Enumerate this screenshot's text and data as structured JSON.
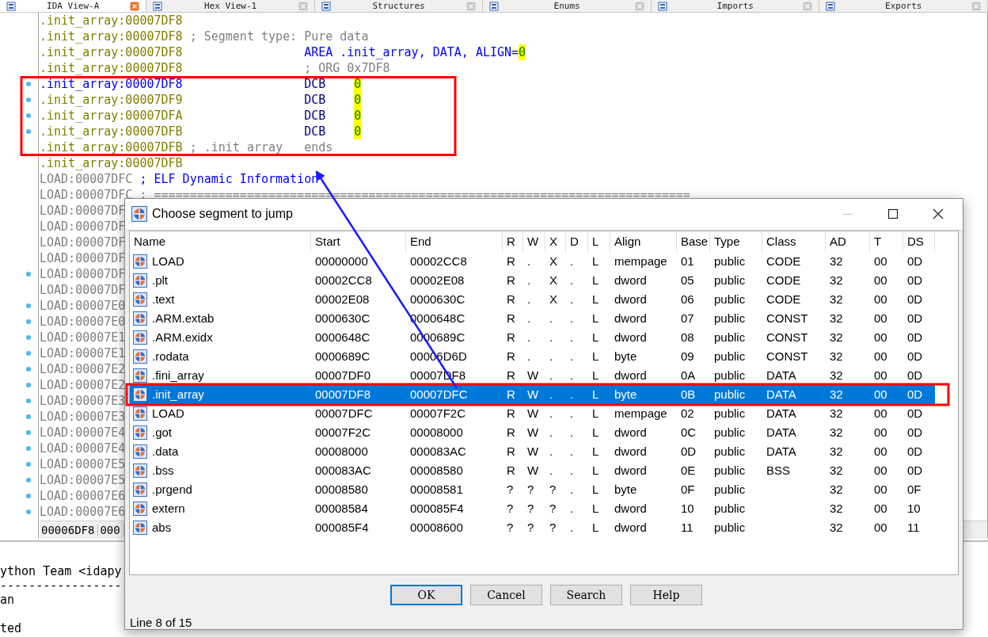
{
  "tabs": [
    {
      "label": "IDA View-A",
      "selected": true
    },
    {
      "label": "Hex View-1",
      "selected": false
    },
    {
      "label": "Structures",
      "selected": false
    },
    {
      "label": "Enums",
      "selected": false
    },
    {
      "label": "Imports",
      "selected": false
    },
    {
      "label": "Exports",
      "selected": false
    }
  ],
  "listing": {
    "lines": [
      {
        "address": ".init_array:00007DF8",
        "greyed": false,
        "current": false,
        "marked": false
      },
      {
        "address": ".init_array:00007DF8",
        "greyed": false,
        "current": false,
        "marked": false,
        "parts": [
          {
            "text": "; Segment type: Pure data",
            "kind": "comment"
          }
        ]
      },
      {
        "address": ".init_array:00007DF8",
        "greyed": false,
        "current": false,
        "marked": false,
        "parts": [
          {
            "text": "AREA .init_array, DATA, ALIGN=",
            "kind": "directive"
          },
          {
            "text": "0",
            "kind": "number"
          }
        ]
      },
      {
        "address": ".init_array:00007DF8",
        "greyed": false,
        "current": false,
        "marked": false,
        "parts": [
          {
            "text": "; ORG 0x7DF8",
            "kind": "column_comment"
          }
        ]
      },
      {
        "address": ".init_array:00007DF8",
        "greyed": false,
        "current": true,
        "marked": true,
        "parts": [
          {
            "text": "DCB",
            "kind": "mnemonic"
          },
          {
            "text": "0",
            "kind": "number"
          }
        ]
      },
      {
        "address": ".init_array:00007DF9",
        "greyed": false,
        "current": false,
        "marked": true,
        "parts": [
          {
            "text": "DCB",
            "kind": "mnemonic"
          },
          {
            "text": "0",
            "kind": "number"
          }
        ]
      },
      {
        "address": ".init_array:00007DFA",
        "greyed": false,
        "current": false,
        "marked": true,
        "parts": [
          {
            "text": "DCB",
            "kind": "mnemonic"
          },
          {
            "text": "0",
            "kind": "number"
          }
        ]
      },
      {
        "address": ".init_array:00007DFB",
        "greyed": false,
        "current": false,
        "marked": true,
        "parts": [
          {
            "text": "DCB",
            "kind": "mnemonic"
          },
          {
            "text": "0",
            "kind": "number"
          }
        ]
      },
      {
        "address": ".init_array:00007DFB",
        "greyed": false,
        "current": false,
        "marked": false,
        "parts": [
          {
            "text": "; .init_array",
            "kind": "comment"
          },
          {
            "text": "ends",
            "kind": "column_comment"
          }
        ]
      },
      {
        "address": ".init_array:00007DFB",
        "greyed": false,
        "current": false,
        "marked": false
      },
      {
        "address": "LOAD:00007DFC",
        "greyed": true,
        "current": false,
        "marked": false,
        "parts": [
          {
            "text": "; ELF Dynamic Information",
            "kind": "info"
          }
        ]
      },
      {
        "address": "LOAD:00007DFC",
        "greyed": true,
        "current": false,
        "marked": false,
        "parts": [
          {
            "text": "; ===========================================================================",
            "kind": "comment"
          }
        ]
      },
      {
        "address": "LOAD:00007DF",
        "greyed": true,
        "current": false,
        "marked": false
      },
      {
        "address": "LOAD:00007DF",
        "greyed": true,
        "current": false,
        "marked": false
      },
      {
        "address": "LOAD:00007DF",
        "greyed": true,
        "current": false,
        "marked": false
      },
      {
        "address": "LOAD:00007DF",
        "greyed": true,
        "current": false,
        "marked": false
      },
      {
        "address": "LOAD:00007DF",
        "greyed": true,
        "current": false,
        "marked": true
      },
      {
        "address": "LOAD:00007DF",
        "greyed": true,
        "current": false,
        "marked": false
      },
      {
        "address": "LOAD:00007E0",
        "greyed": true,
        "current": false,
        "marked": true
      },
      {
        "address": "LOAD:00007E0",
        "greyed": true,
        "current": false,
        "marked": true
      },
      {
        "address": "LOAD:00007E1",
        "greyed": true,
        "current": false,
        "marked": true
      },
      {
        "address": "LOAD:00007E1",
        "greyed": true,
        "current": false,
        "marked": true
      },
      {
        "address": "LOAD:00007E2",
        "greyed": true,
        "current": false,
        "marked": true
      },
      {
        "address": "LOAD:00007E2",
        "greyed": true,
        "current": false,
        "marked": true
      },
      {
        "address": "LOAD:00007E3",
        "greyed": true,
        "current": false,
        "marked": true
      },
      {
        "address": "LOAD:00007E3",
        "greyed": true,
        "current": false,
        "marked": true
      },
      {
        "address": "LOAD:00007E4",
        "greyed": true,
        "current": false,
        "marked": true
      },
      {
        "address": "LOAD:00007E4",
        "greyed": true,
        "current": false,
        "marked": true
      },
      {
        "address": "LOAD:00007E5",
        "greyed": true,
        "current": false,
        "marked": true
      },
      {
        "address": "LOAD:00007E5",
        "greyed": true,
        "current": false,
        "marked": true
      },
      {
        "address": "LOAD:00007E6",
        "greyed": true,
        "current": false,
        "marked": true
      },
      {
        "address": "LOAD:00007E6",
        "greyed": true,
        "current": false,
        "marked": true
      }
    ],
    "status": [
      "00006DF8",
      "000"
    ]
  },
  "output": {
    "lines": [
      {
        "text": "ython Team <idapy",
        "blank_before": false
      },
      {
        "text": "-----------------",
        "blank_before": false
      },
      {
        "text": "an",
        "blank_before": false
      },
      {
        "text": "ted",
        "blank_before": true
      }
    ]
  },
  "dialog": {
    "title": "Choose segment to jump",
    "window_controls": [
      {
        "kind": "minimize",
        "disabled": true
      },
      {
        "kind": "maximize",
        "disabled": false
      },
      {
        "kind": "close",
        "disabled": false
      }
    ],
    "columns": [
      "Name",
      "Start",
      "End",
      "R",
      "W",
      "X",
      "D",
      "L",
      "Align",
      "Base",
      "Type",
      "Class",
      "AD",
      "T",
      "DS"
    ],
    "rows": [
      {
        "selected": false,
        "cells": [
          "LOAD",
          "00000000",
          "00002CC8",
          "R",
          ".",
          "X",
          ".",
          "L",
          "mempage",
          "01",
          "public",
          "CODE",
          "32",
          "00",
          "0D"
        ]
      },
      {
        "selected": false,
        "cells": [
          ".plt",
          "00002CC8",
          "00002E08",
          "R",
          ".",
          "X",
          ".",
          "L",
          "dword",
          "05",
          "public",
          "CODE",
          "32",
          "00",
          "0D"
        ]
      },
      {
        "selected": false,
        "cells": [
          ".text",
          "00002E08",
          "0000630C",
          "R",
          ".",
          "X",
          ".",
          "L",
          "dword",
          "06",
          "public",
          "CODE",
          "32",
          "00",
          "0D"
        ]
      },
      {
        "selected": false,
        "cells": [
          ".ARM.extab",
          "0000630C",
          "0000648C",
          "R",
          ".",
          ".",
          ".",
          "L",
          "dword",
          "07",
          "public",
          "CONST",
          "32",
          "00",
          "0D"
        ]
      },
      {
        "selected": false,
        "cells": [
          ".ARM.exidx",
          "0000648C",
          "0000689C",
          "R",
          ".",
          ".",
          ".",
          "L",
          "dword",
          "08",
          "public",
          "CONST",
          "32",
          "00",
          "0D"
        ]
      },
      {
        "selected": false,
        "cells": [
          ".rodata",
          "0000689C",
          "00006D6D",
          "R",
          ".",
          ".",
          ".",
          "L",
          "byte",
          "09",
          "public",
          "CONST",
          "32",
          "00",
          "0D"
        ]
      },
      {
        "selected": false,
        "cells": [
          ".fini_array",
          "00007DF0",
          "00007DF8",
          "R",
          "W",
          ".",
          ".",
          "L",
          "dword",
          "0A",
          "public",
          "DATA",
          "32",
          "00",
          "0D"
        ]
      },
      {
        "selected": true,
        "cells": [
          ".init_array",
          "00007DF8",
          "00007DFC",
          "R",
          "W",
          ".",
          ".",
          "L",
          "byte",
          "0B",
          "public",
          "DATA",
          "32",
          "00",
          "0D"
        ]
      },
      {
        "selected": false,
        "cells": [
          "LOAD",
          "00007DFC",
          "00007F2C",
          "R",
          "W",
          ".",
          ".",
          "L",
          "mempage",
          "02",
          "public",
          "DATA",
          "32",
          "00",
          "0D"
        ]
      },
      {
        "selected": false,
        "cells": [
          ".got",
          "00007F2C",
          "00008000",
          "R",
          "W",
          ".",
          ".",
          "L",
          "dword",
          "0C",
          "public",
          "DATA",
          "32",
          "00",
          "0D"
        ]
      },
      {
        "selected": false,
        "cells": [
          ".data",
          "00008000",
          "000083AC",
          "R",
          "W",
          ".",
          ".",
          "L",
          "dword",
          "0D",
          "public",
          "DATA",
          "32",
          "00",
          "0D"
        ]
      },
      {
        "selected": false,
        "cells": [
          ".bss",
          "000083AC",
          "00008580",
          "R",
          "W",
          ".",
          ".",
          "L",
          "dword",
          "0E",
          "public",
          "BSS",
          "32",
          "00",
          "0D"
        ]
      },
      {
        "selected": false,
        "cells": [
          ".prgend",
          "00008580",
          "00008581",
          "?",
          "?",
          "?",
          ".",
          "L",
          "byte",
          "0F",
          "public",
          null,
          "32",
          "00",
          "0F"
        ]
      },
      {
        "selected": false,
        "cells": [
          "extern",
          "00008584",
          "000085F4",
          "?",
          "?",
          "?",
          ".",
          "L",
          "dword",
          "10",
          "public",
          null,
          "32",
          "00",
          "10"
        ]
      },
      {
        "selected": false,
        "cells": [
          "abs",
          "000085F4",
          "00008600",
          "?",
          "?",
          "?",
          ".",
          "L",
          "dword",
          "11",
          "public",
          null,
          "32",
          "00",
          "11"
        ]
      }
    ],
    "buttons": [
      {
        "label": "OK",
        "default": true
      },
      {
        "label": "Cancel",
        "default": false
      },
      {
        "label": "Search",
        "default": false
      },
      {
        "label": "Help",
        "default": false
      }
    ],
    "status": "Line 8 of 15"
  }
}
